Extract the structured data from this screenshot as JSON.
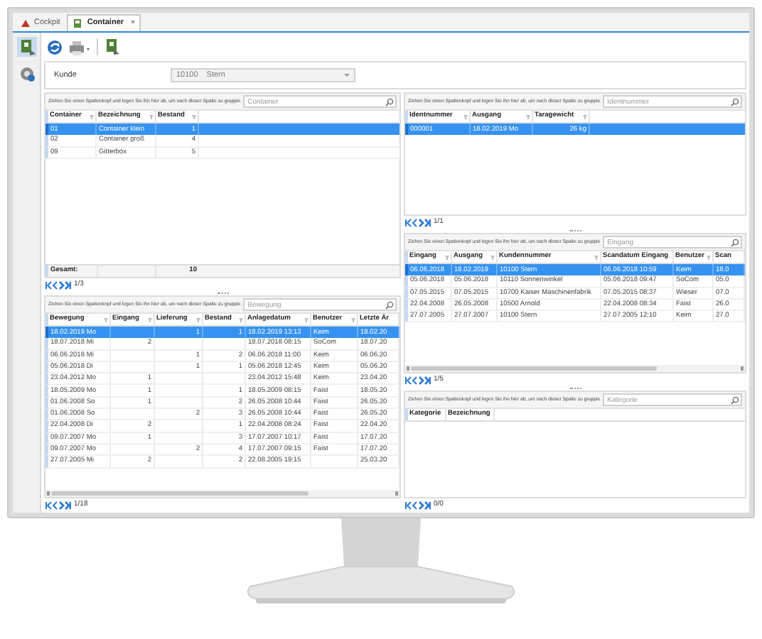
{
  "tabs": [
    {
      "label": "Cockpit",
      "selected": false
    },
    {
      "label": "Container",
      "selected": true,
      "close": "×"
    }
  ],
  "kunde": {
    "label": "Kunde",
    "number": "10100",
    "name": "Stern",
    "disabled": true
  },
  "left_panels": [
    {
      "group_hint": "Ziehen Sie einen Spaltenkopf und legen Sie ihn hier ab, um nach dieser Spalte zu gruppie",
      "search_placeholder": "Container",
      "columns": [
        "Container",
        "Bezeichnung",
        "Bestand"
      ],
      "rows": [
        {
          "selected": true,
          "cells": [
            "01",
            "Container klein",
            "1"
          ]
        },
        {
          "selected": false,
          "cells": [
            "02",
            "Container groß",
            "4"
          ]
        },
        {
          "selected": false,
          "cells": [
            "09",
            "Gitterbox",
            "5"
          ]
        }
      ],
      "footer": {
        "label": "Gesamt:",
        "total": "10"
      },
      "pager": "1/3"
    },
    {
      "group_hint": "Ziehen Sie einen Spaltenkopf und legen Sie ihn hier ab, um nach dieser Spalte zu gruppie",
      "search_placeholder": "Bewegung",
      "columns": [
        "Bewegung",
        "Eingang",
        "Lieferung",
        "Bestand",
        "Anlagedatum",
        "Benutzer",
        "Letzte Är"
      ],
      "rows": [
        {
          "selected": true,
          "cells": [
            "18.02.2019   Mo",
            "",
            "1",
            "1",
            "18.02.2019 13:13",
            "Keim",
            "18.02.20"
          ]
        },
        {
          "selected": false,
          "cells": [
            "18.07.2018   Mi",
            "2",
            "",
            "",
            "18.07.2018 08:15",
            "SoCom",
            "18.07.20"
          ]
        },
        {
          "selected": false,
          "cells": [
            "06.06.2018   Mi",
            "",
            "1",
            "2",
            "06.06.2018 11:00",
            "Keim",
            "06.06.20"
          ]
        },
        {
          "selected": false,
          "cells": [
            "05.06.2018   Di",
            "",
            "1",
            "1",
            "05.06.2018 12:45",
            "Keim",
            "05.06.20"
          ]
        },
        {
          "selected": false,
          "cells": [
            "23.04.2012   Mo",
            "1",
            "",
            "",
            "23.04.2012 15:48",
            "Keim",
            "23.04.20"
          ]
        },
        {
          "selected": false,
          "cells": [
            "18.05.2009   Mo",
            "1",
            "",
            "1",
            "18.05.2009 08:15",
            "Faist",
            "18.05.20"
          ]
        },
        {
          "selected": false,
          "cells": [
            "01.06.2008   So",
            "1",
            "",
            "2",
            "26.05.2008 10:44",
            "Faist",
            "26.05.20"
          ]
        },
        {
          "selected": false,
          "cells": [
            "01.06.2008   So",
            "",
            "2",
            "3",
            "26.05.2008 10:44",
            "Faist",
            "26.05.20"
          ]
        },
        {
          "selected": false,
          "cells": [
            "22.04.2008   Di",
            "2",
            "",
            "1",
            "22.04.2008 08:24",
            "Faist",
            "22.04.20"
          ]
        },
        {
          "selected": false,
          "cells": [
            "09.07.2007   Mo",
            "1",
            "",
            "3",
            "17.07.2007 10:17",
            "Faist",
            "17.07.20"
          ]
        },
        {
          "selected": false,
          "cells": [
            "09.07.2007   Mo",
            "",
            "2",
            "4",
            "17.07.2007 09:15",
            "Faist",
            "17.07.20"
          ]
        },
        {
          "selected": false,
          "cells": [
            "27.07.2005   Mi",
            "2",
            "",
            "2",
            "22.08.2005 19:15",
            "",
            "25.03.20"
          ]
        }
      ],
      "pager": "1/18",
      "scrollbar": true
    }
  ],
  "right_panels": [
    {
      "group_hint": "Ziehen Sie einen Spaltenkopf und legen Sie ihn hier ab, um nach dieser Spalte zu gruppie",
      "search_placeholder": "Identnummer",
      "columns": [
        "Identnummer",
        "Ausgang",
        "Taragewicht"
      ],
      "rows": [
        {
          "selected": true,
          "cells": [
            "000001",
            "18.02.2019   Mo",
            "26 kg"
          ]
        }
      ],
      "pager": "1/1"
    },
    {
      "group_hint": "Ziehen Sie einen Spaltenkopf und legen Sie ihn hier ab, um nach dieser Spalte zu gruppie",
      "search_placeholder": "Eingang",
      "columns": [
        "Eingang",
        "Ausgang",
        "Kundennummer",
        "Scandatum Eingang",
        "Benutzer",
        "Scan"
      ],
      "rows": [
        {
          "selected": true,
          "cells": [
            "06.06.2018",
            "18.02.2019",
            "10100   Stern",
            "06.06.2018 10:59",
            "Keim",
            "18.0"
          ]
        },
        {
          "selected": false,
          "cells": [
            "05.06.2018",
            "05.06.2018",
            "10110   Sonnenwinkel",
            "05.06.2018 09:47",
            "SoCom",
            "05.0"
          ]
        },
        {
          "selected": false,
          "cells": [
            "07.05.2015",
            "07.05.2015",
            "10700   Kaiser Maschinenfabrik",
            "07.05.2015 08:37",
            "Wieser",
            "07.0"
          ]
        },
        {
          "selected": false,
          "cells": [
            "22.04.2008",
            "26.05.2008",
            "10500   Arnold",
            "22.04.2008 08:34",
            "Faist",
            "26.0"
          ]
        },
        {
          "selected": false,
          "cells": [
            "27.07.2005",
            "27.07.2007",
            "10100   Stern",
            "27.07.2005 12:10",
            "Keim",
            "27.0"
          ]
        }
      ],
      "pager": "1/5",
      "scrollbar": true
    },
    {
      "group_hint": "Ziehen Sie einen Spaltenkopf und legen Sie ihn hier ab, um nach dieser Spalte zu gruppie",
      "search_placeholder": "Kategorie",
      "columns": [
        "Kategorie",
        "Bezeichnung"
      ],
      "pager": "0/0"
    }
  ]
}
